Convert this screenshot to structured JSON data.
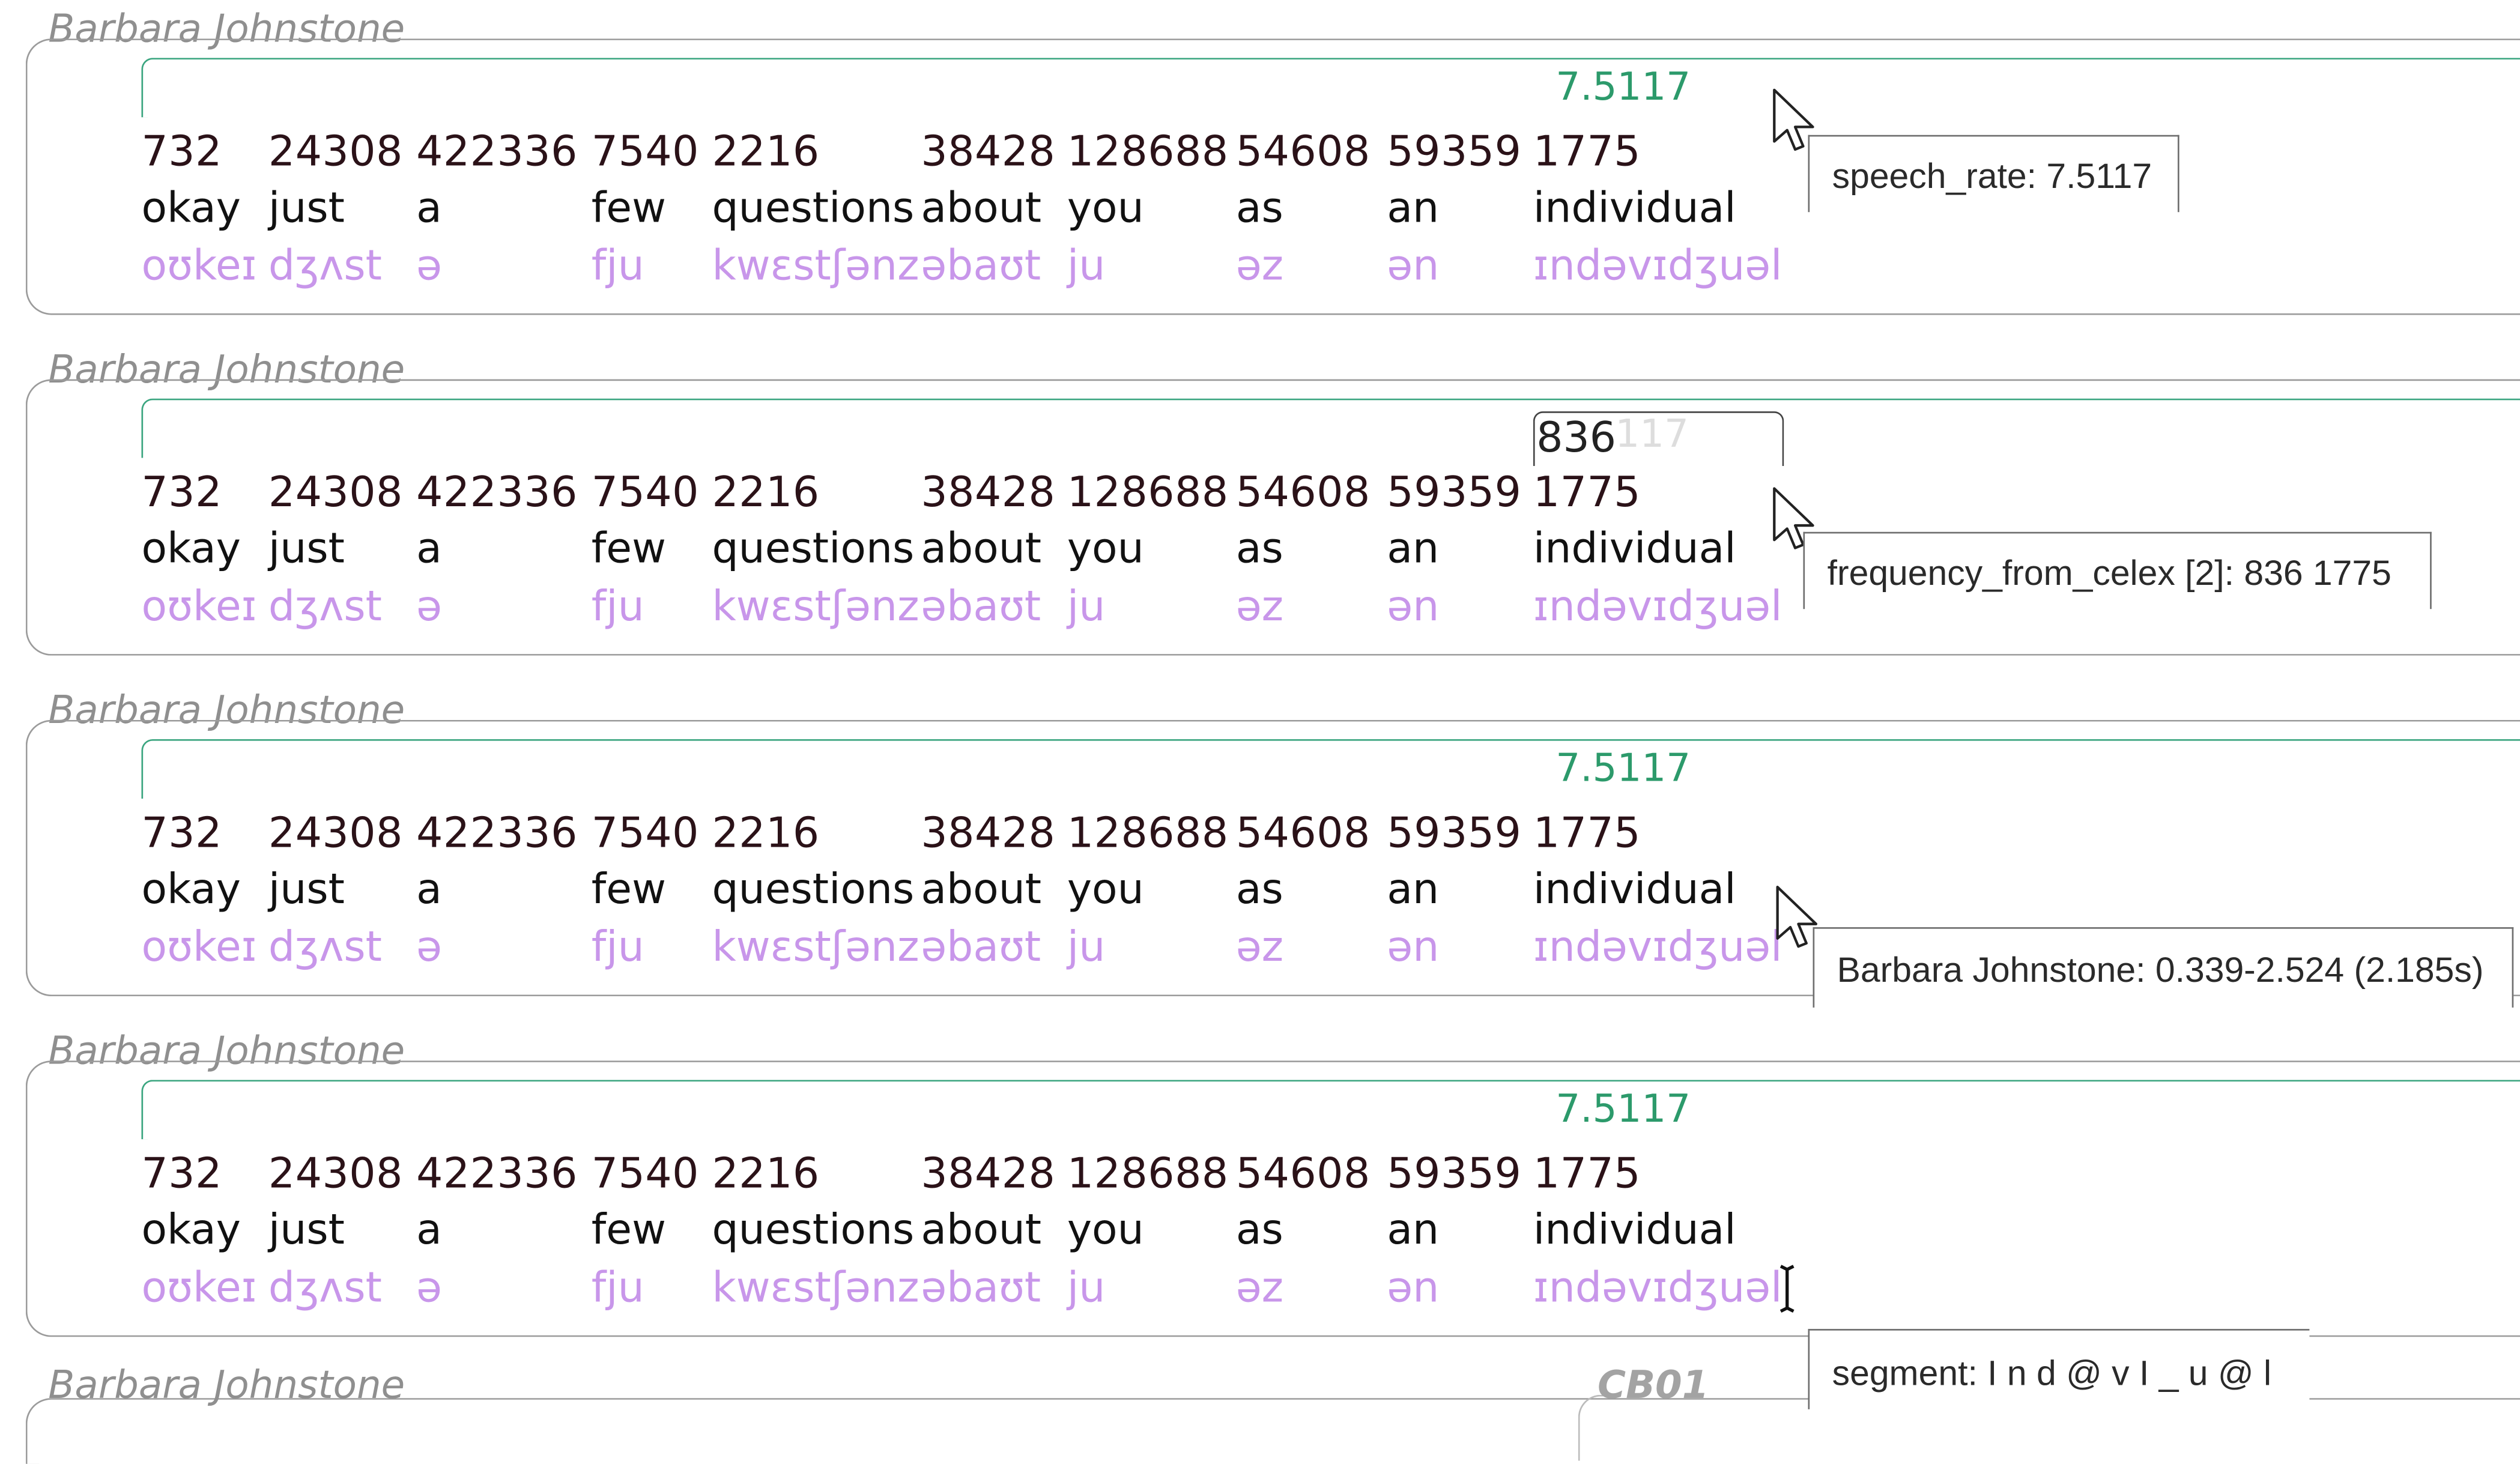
{
  "speaker": "Barbara Johnstone",
  "speech_rate": "7.5117",
  "word_columns": [
    {
      "num": "732",
      "orth": "okay",
      "ipa": "oʊkeɪ"
    },
    {
      "num": "24308",
      "orth": "just",
      "ipa": "dʒʌst"
    },
    {
      "num": "422336",
      "orth": "a",
      "ipa": "ə"
    },
    {
      "num": "7540",
      "orth": "few",
      "ipa": "fju"
    },
    {
      "num": "2216",
      "orth": "questions",
      "ipa": "kwɛstʃənz"
    },
    {
      "num": "38428",
      "orth": "about",
      "ipa": "əbaʊt"
    },
    {
      "num": "128688",
      "orth": "you",
      "ipa": "ju"
    },
    {
      "num": "54608",
      "orth": "as",
      "ipa": "əz"
    },
    {
      "num": "59359",
      "orth": "an",
      "ipa": "ən"
    },
    {
      "num": "1775",
      "orth": "individual",
      "ipa": "ɪndəvɪdʒuəl"
    }
  ],
  "frequency_edit_value": "836",
  "frequency_edit_ghost": "117",
  "tooltips": {
    "speech_rate": "speech_rate: 7.5117",
    "frequency": "frequency_from_celex [2]: 836 1775",
    "utterance": "Barbara Johnstone: 0.339-2.524 (2.185s)",
    "segment": "segment: I n d @ v I _ u @ l"
  },
  "next_utterance_label": "CB01",
  "colors": {
    "span_line": "#3aa57f",
    "rate_text": "#2c9a6b",
    "ipa_text": "#c896ea",
    "speaker_text": "#8f8f8f"
  }
}
